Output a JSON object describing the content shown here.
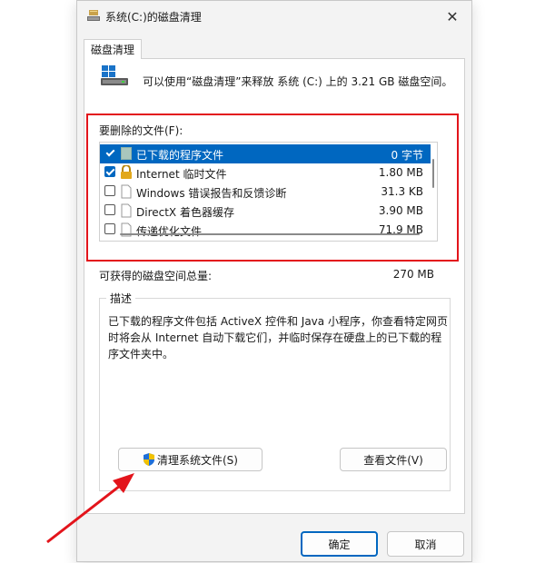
{
  "window": {
    "title": "系统(C:)的磁盘清理",
    "close_glyph": "✕"
  },
  "tab": {
    "label": "磁盘清理"
  },
  "info": {
    "text": "可以使用“磁盘清理”来释放 系统 (C:) 上的 3.21 GB 磁盘空间。"
  },
  "files": {
    "label": "要删除的文件(F):",
    "items": [
      {
        "name": "已下载的程序文件",
        "size": "0 字节",
        "checked": true,
        "selected": true,
        "icon": "folder-icon"
      },
      {
        "name": "Internet 临时文件",
        "size": "1.80 MB",
        "checked": true,
        "selected": false,
        "icon": "lock-icon"
      },
      {
        "name": "Windows 错误报告和反馈诊断",
        "size": "31.3 KB",
        "checked": false,
        "selected": false,
        "icon": "document-icon"
      },
      {
        "name": "DirectX 着色器缓存",
        "size": "3.90 MB",
        "checked": false,
        "selected": false,
        "icon": "document-icon"
      },
      {
        "name": "传递优化文件",
        "size": "71.9 MB",
        "checked": false,
        "selected": false,
        "icon": "document-icon"
      }
    ]
  },
  "available": {
    "label": "可获得的磁盘空间总量:",
    "value": "270 MB"
  },
  "description": {
    "legend": "描述",
    "text": "已下载的程序文件包括 ActiveX 控件和 Java 小程序，你查看特定网页时将会从 Internet 自动下载它们，并临时保存在硬盘上的已下载的程序文件夹中。"
  },
  "buttons": {
    "clean_system": "清理系统文件(S)",
    "view_files": "查看文件(V)",
    "ok": "确定",
    "cancel": "取消"
  },
  "colors": {
    "accent": "#0067c0",
    "highlight_box": "#e3141b",
    "window_bg": "#f3f3f3"
  }
}
